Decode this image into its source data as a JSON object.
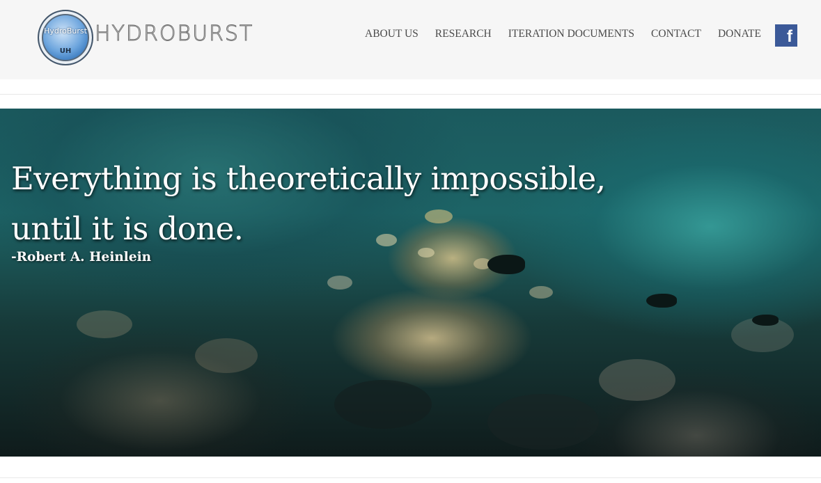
{
  "header": {
    "logo_badge_text": "HydroBurst",
    "logo_badge_mark": "UH",
    "logo_wordmark": "HYDROBURST",
    "nav": [
      {
        "label": "ABOUT US"
      },
      {
        "label": "RESEARCH"
      },
      {
        "label": "ITERATION DOCUMENTS"
      },
      {
        "label": "CONTACT"
      },
      {
        "label": "DONATE"
      }
    ],
    "facebook_glyph": "f"
  },
  "hero": {
    "quote_line1": "Everything is theoretically impossible,",
    "quote_line2": "until it is done.",
    "author": "-Robert A. Heinlein",
    "background": "underwater coral reef"
  },
  "colors": {
    "header_bg": "#f6f6f6",
    "nav_text": "#4a4a4a",
    "facebook_blue": "#3b5998",
    "hero_text": "#ffffff"
  },
  "icons": {
    "facebook": "facebook-icon",
    "logo": "hydroburst-logo-icon"
  }
}
